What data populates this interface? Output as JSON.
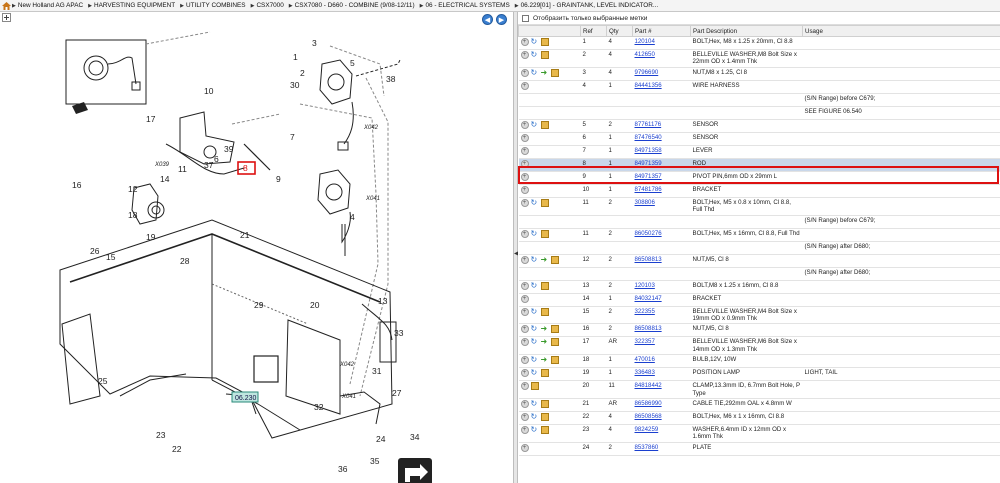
{
  "breadcrumb": [
    "New Holland AG APAC",
    "HARVESTING EQUIPMENT",
    "UTILITY COMBINES",
    "CSX7000",
    "CSX7080 - D660 - COMBINE (9/08-12/11)",
    "06 - ELECTRICAL SYSTEMS",
    "06.229[01] - GRAINTANK, LEVEL INDICATOR..."
  ],
  "filter_label": "Отобразить только выбранные метки",
  "columns": [
    "Ref",
    "Qty",
    "Part #",
    "Part Description",
    "Usage"
  ],
  "rows": [
    {
      "icons": [
        "add",
        "info",
        "box"
      ],
      "ref": "1",
      "qty": "4",
      "part": "120104",
      "desc": "BOLT,Hex, M8 x 1.25 x 20mm, Cl 8.8",
      "usage": ""
    },
    {
      "icons": [
        "add",
        "info",
        "box"
      ],
      "ref": "2",
      "qty": "4",
      "part": "412650",
      "desc": "BELLEVILLE WASHER,M8 Bolt Size x 22mm OD x 1.4mm Thk",
      "usage": ""
    },
    {
      "icons": [
        "add",
        "info",
        "swap",
        "box"
      ],
      "ref": "3",
      "qty": "4",
      "part": "9796690",
      "desc": "NUT,M8 x 1.25, Cl 8",
      "usage": ""
    },
    {
      "icons": [
        "add"
      ],
      "ref": "4",
      "qty": "1",
      "part": "84441356",
      "desc": "WIRE HARNESS",
      "usage": ""
    },
    {
      "icons": [],
      "ref": "",
      "qty": "",
      "part": "",
      "desc": "",
      "usage": "(S/N Range) before C679;"
    },
    {
      "icons": [],
      "ref": "",
      "qty": "",
      "part": "",
      "desc": "",
      "usage": "SEE FIGURE 06.540"
    },
    {
      "icons": [
        "add",
        "info",
        "box"
      ],
      "ref": "5",
      "qty": "2",
      "part": "87761176",
      "desc": "SENSOR",
      "usage": ""
    },
    {
      "icons": [
        "add"
      ],
      "ref": "6",
      "qty": "1",
      "part": "87476540",
      "desc": "SENSOR",
      "usage": ""
    },
    {
      "icons": [
        "add"
      ],
      "ref": "7",
      "qty": "1",
      "part": "84971358",
      "desc": "LEVER",
      "usage": ""
    },
    {
      "icons": [
        "add"
      ],
      "ref": "8",
      "qty": "1",
      "part": "84971359",
      "desc": "ROD",
      "usage": "",
      "selected": true
    },
    {
      "icons": [
        "add"
      ],
      "ref": "9",
      "qty": "1",
      "part": "84971357",
      "desc": "PIVOT PIN,6mm OD x 29mm L",
      "usage": ""
    },
    {
      "icons": [
        "add"
      ],
      "ref": "10",
      "qty": "1",
      "part": "87481786",
      "desc": "BRACKET",
      "usage": ""
    },
    {
      "icons": [
        "add",
        "info",
        "box"
      ],
      "ref": "11",
      "qty": "2",
      "part": "308806",
      "desc": "BOLT,Hex, M5 x 0.8 x 10mm, Cl 8.8, Full Thd",
      "usage": ""
    },
    {
      "icons": [],
      "ref": "",
      "qty": "",
      "part": "",
      "desc": "",
      "usage": "(S/N Range) before C679;"
    },
    {
      "icons": [
        "add",
        "info",
        "box"
      ],
      "ref": "11",
      "qty": "2",
      "part": "86050276",
      "desc": "BOLT,Hex, M5 x 16mm, Cl 8.8, Full Thd",
      "usage": ""
    },
    {
      "icons": [],
      "ref": "",
      "qty": "",
      "part": "",
      "desc": "",
      "usage": "(S/N Range) after D680;"
    },
    {
      "icons": [
        "add",
        "info",
        "swap",
        "box"
      ],
      "ref": "12",
      "qty": "2",
      "part": "86508813",
      "desc": "NUT,M5, Cl 8",
      "usage": ""
    },
    {
      "icons": [],
      "ref": "",
      "qty": "",
      "part": "",
      "desc": "",
      "usage": "(S/N Range) after D680;"
    },
    {
      "icons": [
        "add",
        "info",
        "box"
      ],
      "ref": "13",
      "qty": "2",
      "part": "120103",
      "desc": "BOLT,M8 x 1.25 x 16mm, Cl 8.8",
      "usage": ""
    },
    {
      "icons": [
        "add"
      ],
      "ref": "14",
      "qty": "1",
      "part": "84032147",
      "desc": "BRACKET",
      "usage": ""
    },
    {
      "icons": [
        "add",
        "info",
        "box"
      ],
      "ref": "15",
      "qty": "2",
      "part": "322355",
      "desc": "BELLEVILLE WASHER,M4 Bolt Size x 19mm OD x 0.9mm Thk",
      "usage": ""
    },
    {
      "icons": [
        "add",
        "info",
        "swap",
        "box"
      ],
      "ref": "16",
      "qty": "2",
      "part": "86508813",
      "desc": "NUT,M5, Cl 8",
      "usage": ""
    },
    {
      "icons": [
        "add",
        "info",
        "swap",
        "box"
      ],
      "ref": "17",
      "qty": "AR",
      "part": "322357",
      "desc": "BELLEVILLE WASHER,M6 Bolt Size x 14mm OD x 1.3mm Thk",
      "usage": ""
    },
    {
      "icons": [
        "add",
        "info",
        "swap",
        "box"
      ],
      "ref": "18",
      "qty": "1",
      "part": "470016",
      "desc": "BULB,12V, 10W",
      "usage": ""
    },
    {
      "icons": [
        "add",
        "info",
        "box"
      ],
      "ref": "19",
      "qty": "1",
      "part": "336483",
      "desc": "POSITION LAMP",
      "usage": "LIGHT, TAIL"
    },
    {
      "icons": [
        "add",
        "box"
      ],
      "ref": "20",
      "qty": "11",
      "part": "84818442",
      "desc": "CLAMP,13.3mm ID, 6.7mm Bolt Hole, P Type",
      "usage": ""
    },
    {
      "icons": [
        "add",
        "info",
        "box"
      ],
      "ref": "21",
      "qty": "AR",
      "part": "86586990",
      "desc": "CABLE TIE,292mm OAL x 4.8mm W",
      "usage": ""
    },
    {
      "icons": [
        "add",
        "info",
        "box"
      ],
      "ref": "22",
      "qty": "4",
      "part": "86508568",
      "desc": "BOLT,Hex, M6 x 1 x 16mm, Cl 8.8",
      "usage": ""
    },
    {
      "icons": [
        "add",
        "info",
        "box"
      ],
      "ref": "23",
      "qty": "4",
      "part": "9824259",
      "desc": "WASHER,6.4mm ID x 12mm OD x 1.6mm Thk",
      "usage": ""
    },
    {
      "icons": [
        "add"
      ],
      "ref": "24",
      "qty": "2",
      "part": "8537860",
      "desc": "PLATE",
      "usage": ""
    }
  ],
  "diagram": {
    "labels": [
      "1",
      "2",
      "3",
      "4",
      "5",
      "6",
      "7",
      "8",
      "9",
      "10",
      "11",
      "12",
      "13",
      "14",
      "15",
      "16",
      "17",
      "18",
      "19",
      "20",
      "21",
      "22",
      "23",
      "24",
      "25",
      "26",
      "27",
      "28",
      "29",
      "30",
      "31",
      "32",
      "33",
      "34",
      "35",
      "36",
      "37",
      "38",
      "39"
    ],
    "connectors": [
      "X042",
      "X039",
      "X041",
      "X041",
      "X042",
      "X041"
    ],
    "figure_ref": "06.230"
  }
}
